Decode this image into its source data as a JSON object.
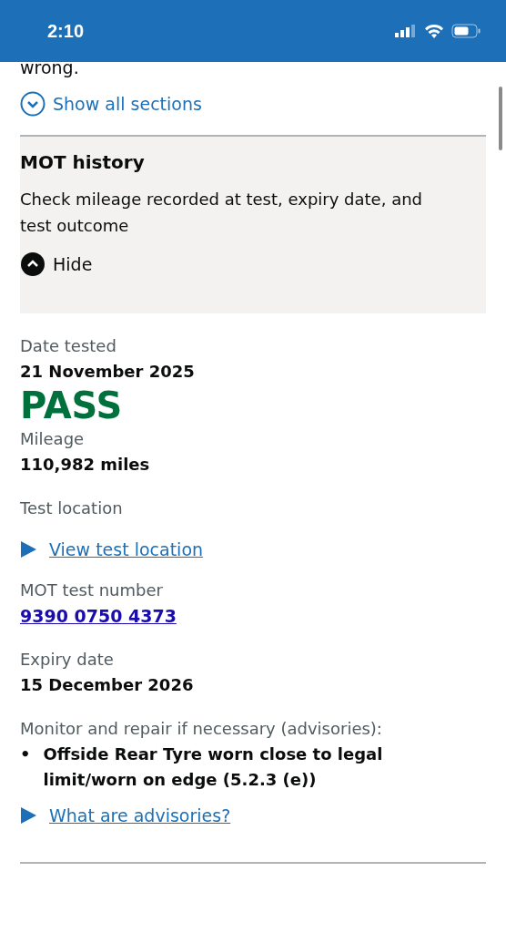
{
  "status_bar": {
    "time": "2:10"
  },
  "intro_tail": "wrong.",
  "show_all": {
    "label": "Show all sections",
    "expanded": false
  },
  "section": {
    "title": "MOT history",
    "summary": "Check mileage recorded at test, expiry date, and test outcome",
    "toggle": "Hide",
    "expanded": true
  },
  "items": [
    {
      "kind": "field",
      "label": "Date tested",
      "value": "21 November 2025"
    },
    {
      "kind": "result",
      "value": "PASS"
    },
    {
      "kind": "field",
      "label": "Mileage",
      "value": "110,982 miles"
    },
    {
      "kind": "details",
      "label": "Test location",
      "link": "View test location",
      "expanded": false
    },
    {
      "kind": "number",
      "label": "MOT test number",
      "value": "9390 0750 4373"
    },
    {
      "kind": "field",
      "label": "Expiry date",
      "value": "15 December 2026"
    },
    {
      "kind": "list",
      "label": "Monitor and repair if necessary (advisories):",
      "marker": "•",
      "entries": [
        "Offside Rear Tyre worn close to legal limit/worn on edge (5.2.3 (e))"
      ]
    },
    {
      "kind": "details",
      "link": "What are advisories?",
      "expanded": false
    }
  ]
}
